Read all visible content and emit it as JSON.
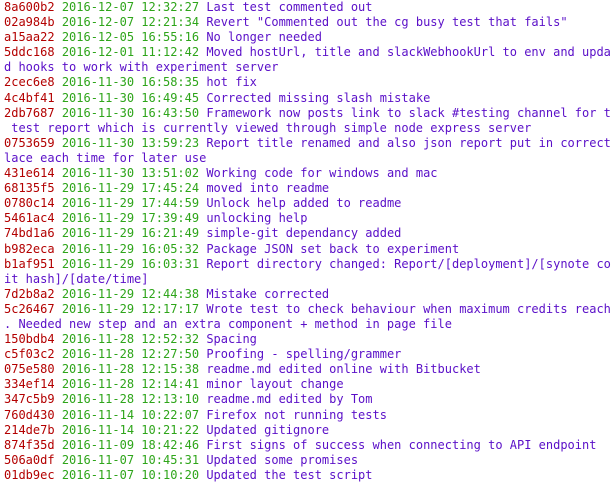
{
  "colors": {
    "hash": "#b30000",
    "date": "#2ea51a",
    "message": "#5a0fc8",
    "background": "#ffffff"
  },
  "commits": [
    {
      "hash": "8a600b2",
      "date": "2016-12-07",
      "time": "12:32:27",
      "message": [
        "Last test commented out"
      ]
    },
    {
      "hash": "02a984b",
      "date": "2016-12-07",
      "time": "12:21:34",
      "message": [
        "Revert \"Commented out the cg busy test that fails\""
      ]
    },
    {
      "hash": "a15aa22",
      "date": "2016-12-05",
      "time": "16:55:16",
      "message": [
        "No longer needed"
      ]
    },
    {
      "hash": "5ddc168",
      "date": "2016-12-01",
      "time": "11:12:42",
      "message": [
        "Moved hostUrl, title and slackWebhookUrl to env and update",
        "d hooks to work with experiment server"
      ]
    },
    {
      "hash": "2cec6e8",
      "date": "2016-11-30",
      "time": "16:58:35",
      "message": [
        "hot fix"
      ]
    },
    {
      "hash": "4c4bf41",
      "date": "2016-11-30",
      "time": "16:49:45",
      "message": [
        "Corrected missing slash mistake"
      ]
    },
    {
      "hash": "2db7687",
      "date": "2016-11-30",
      "time": "16:43:50",
      "message": [
        "Framework now posts link to slack #testing channel for the",
        " test report which is currently viewed through simple node express server"
      ]
    },
    {
      "hash": "0753659",
      "date": "2016-11-30",
      "time": "13:59:23",
      "message": [
        "Report title renamed and also json report put in correct p",
        "lace each time for later use"
      ]
    },
    {
      "hash": "431e614",
      "date": "2016-11-30",
      "time": "13:51:02",
      "message": [
        "Working code for windows and mac"
      ]
    },
    {
      "hash": "68135f5",
      "date": "2016-11-29",
      "time": "17:45:24",
      "message": [
        "moved into readme"
      ]
    },
    {
      "hash": "0780c14",
      "date": "2016-11-29",
      "time": "17:44:59",
      "message": [
        "Unlock help added to readme"
      ]
    },
    {
      "hash": "5461ac4",
      "date": "2016-11-29",
      "time": "17:39:49",
      "message": [
        "unlocking help"
      ]
    },
    {
      "hash": "74bd1a6",
      "date": "2016-11-29",
      "time": "16:21:49",
      "message": [
        "simple-git dependancy added"
      ]
    },
    {
      "hash": "b982eca",
      "date": "2016-11-29",
      "time": "16:05:32",
      "message": [
        "Package JSON set back to experiment"
      ]
    },
    {
      "hash": "b1af951",
      "date": "2016-11-29",
      "time": "16:03:31",
      "message": [
        "Report directory changed: Report/[deployment]/[synote comm",
        "it hash]/[date/time]"
      ]
    },
    {
      "hash": "7d2b8a2",
      "date": "2016-11-29",
      "time": "12:44:38",
      "message": [
        "Mistake corrected"
      ]
    },
    {
      "hash": "5c26467",
      "date": "2016-11-29",
      "time": "12:17:17",
      "message": [
        "Wrote test to check behaviour when maximum credits reached",
        ". Needed new step and an extra component + method in page file"
      ]
    },
    {
      "hash": "150bdb4",
      "date": "2016-11-28",
      "time": "12:52:32",
      "message": [
        "Spacing"
      ]
    },
    {
      "hash": "c5f03c2",
      "date": "2016-11-28",
      "time": "12:27:50",
      "message": [
        "Proofing - spelling/grammer"
      ]
    },
    {
      "hash": "075e580",
      "date": "2016-11-28",
      "time": "12:15:38",
      "message": [
        "readme.md edited online with Bitbucket"
      ]
    },
    {
      "hash": "334ef14",
      "date": "2016-11-28",
      "time": "12:14:41",
      "message": [
        "minor layout change"
      ]
    },
    {
      "hash": "347c5b9",
      "date": "2016-11-28",
      "time": "12:13:10",
      "message": [
        "readme.md edited by Tom"
      ]
    },
    {
      "hash": "760d430",
      "date": "2016-11-14",
      "time": "10:22:07",
      "message": [
        "Firefox not running tests"
      ]
    },
    {
      "hash": "214de7b",
      "date": "2016-11-14",
      "time": "10:21:22",
      "message": [
        "Updated gitignore"
      ]
    },
    {
      "hash": "874f35d",
      "date": "2016-11-09",
      "time": "18:42:46",
      "message": [
        "First signs of success when connecting to API endpoint"
      ]
    },
    {
      "hash": "506a0df",
      "date": "2016-11-07",
      "time": "10:45:31",
      "message": [
        "Updated some promises"
      ]
    },
    {
      "hash": "01db9ec",
      "date": "2016-11-07",
      "time": "10:10:20",
      "message": [
        "Updated the test script"
      ]
    }
  ]
}
